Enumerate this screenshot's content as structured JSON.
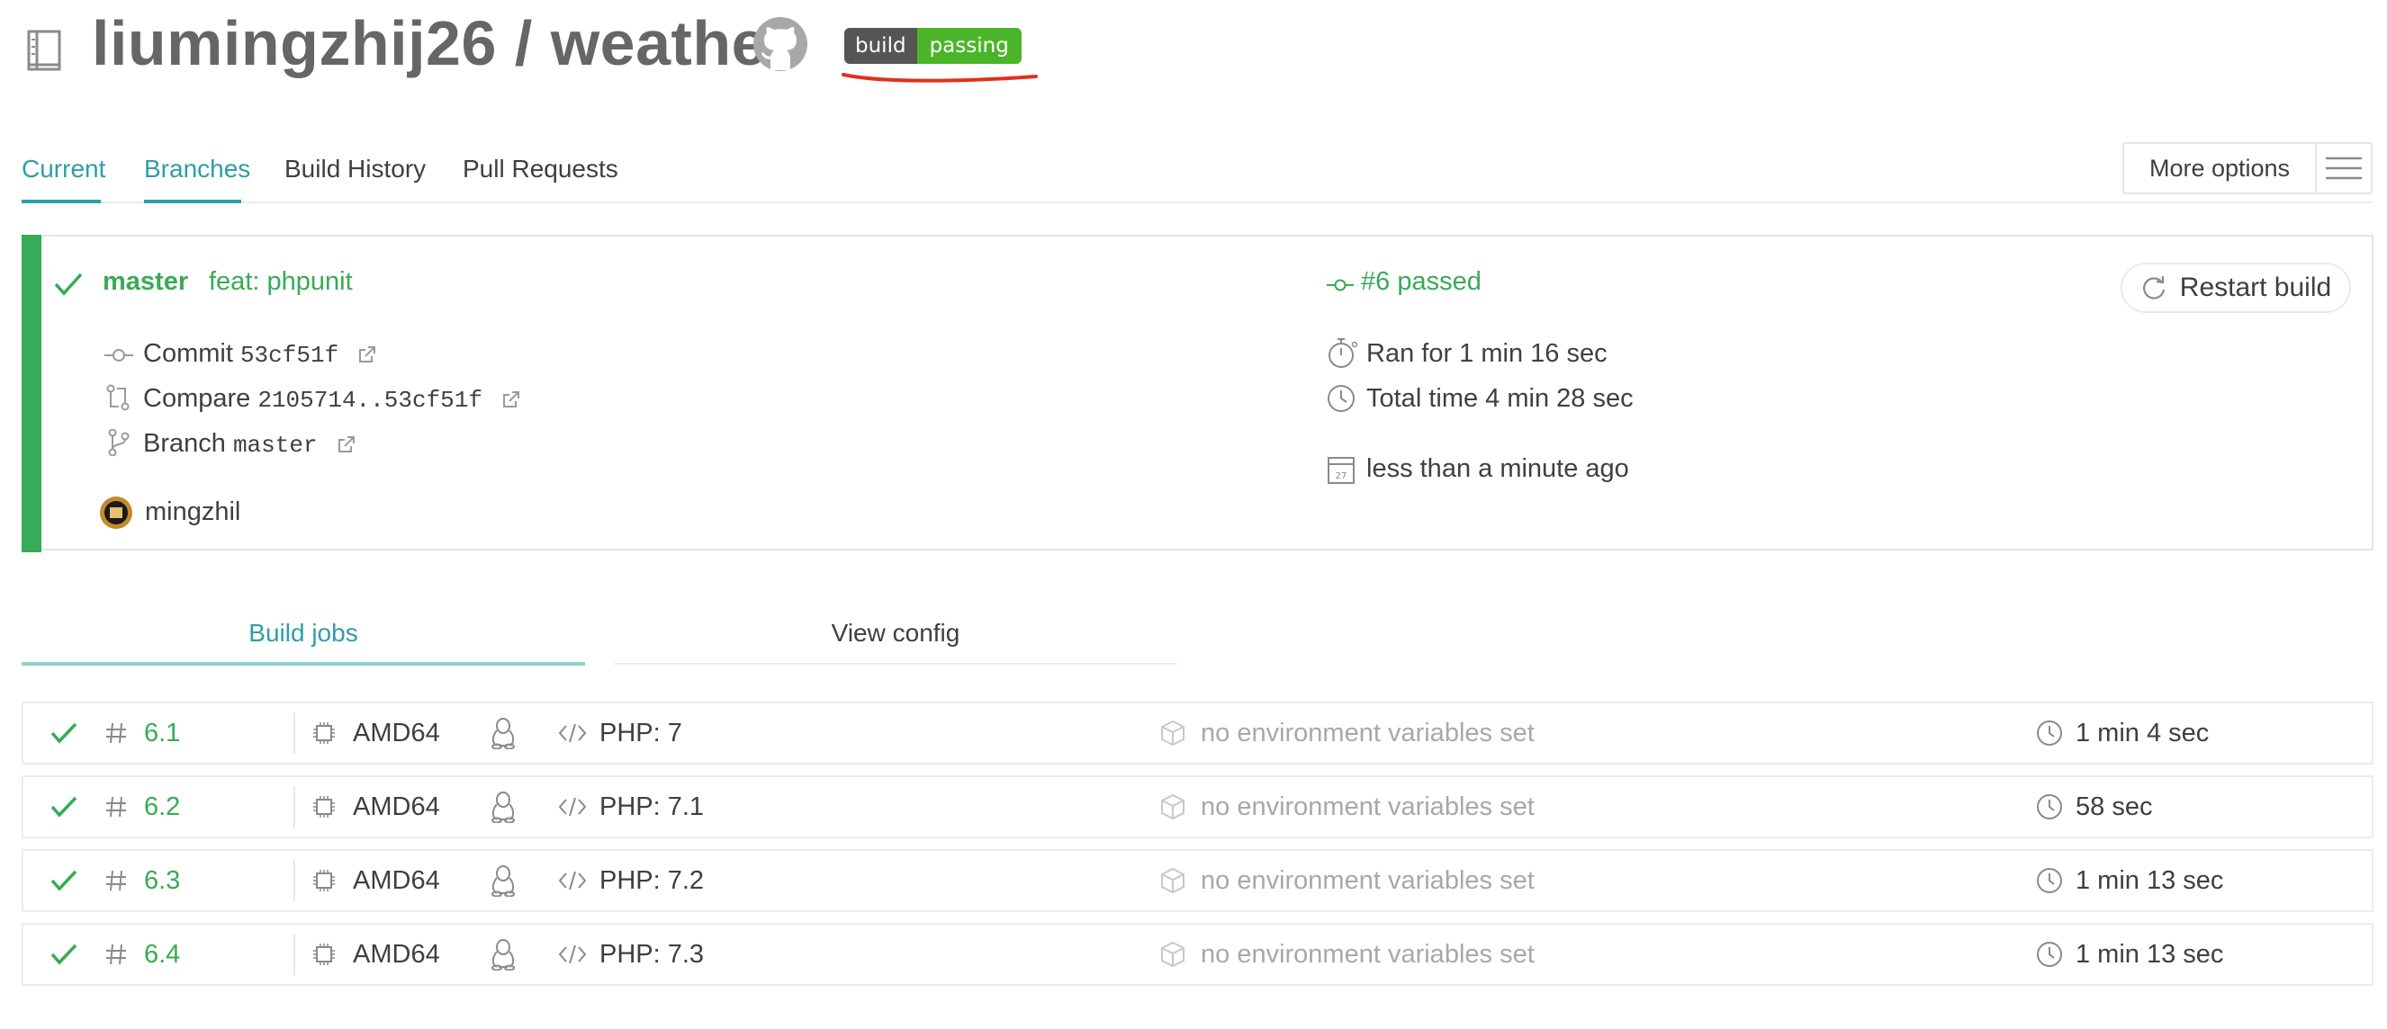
{
  "repo": {
    "title": "liumingzhij26 / weather",
    "badge_left": "build",
    "badge_right": "passing",
    "badge_left_color": "#555555",
    "badge_right_color": "#4bb52a",
    "annotation_color": "#e0311b"
  },
  "tabs": [
    {
      "label": "Current",
      "active": true
    },
    {
      "label": "Branches",
      "active": true
    },
    {
      "label": "Build History",
      "active": false
    },
    {
      "label": "Pull Requests",
      "active": false
    }
  ],
  "more_options_label": "More options",
  "build": {
    "status_color": "#39aa56",
    "branch": "master",
    "message": "feat: phpunit",
    "commit_label": "Commit",
    "commit_hash": "53cf51f",
    "compare_label": "Compare",
    "compare_range": "2105714..53cf51f",
    "branch_label": "Branch",
    "branch_name": "master",
    "author": "mingzhil",
    "build_number_status": "#6 passed",
    "ran_for": "Ran for 1 min 16 sec",
    "total_time": "Total time 4 min 28 sec",
    "when": "less than a minute ago",
    "restart_label": "Restart build"
  },
  "sub_tabs": {
    "build_jobs": "Build jobs",
    "view_config": "View config"
  },
  "jobs": [
    {
      "number": "6.1",
      "arch": "AMD64",
      "lang": "PHP: 7",
      "env": "no environment variables set",
      "duration": "1 min 4 sec"
    },
    {
      "number": "6.2",
      "arch": "AMD64",
      "lang": "PHP: 7.1",
      "env": "no environment variables set",
      "duration": "58 sec"
    },
    {
      "number": "6.3",
      "arch": "AMD64",
      "lang": "PHP: 7.2",
      "env": "no environment variables set",
      "duration": "1 min 13 sec"
    },
    {
      "number": "6.4",
      "arch": "AMD64",
      "lang": "PHP: 7.3",
      "env": "no environment variables set",
      "duration": "1 min 13 sec"
    }
  ]
}
